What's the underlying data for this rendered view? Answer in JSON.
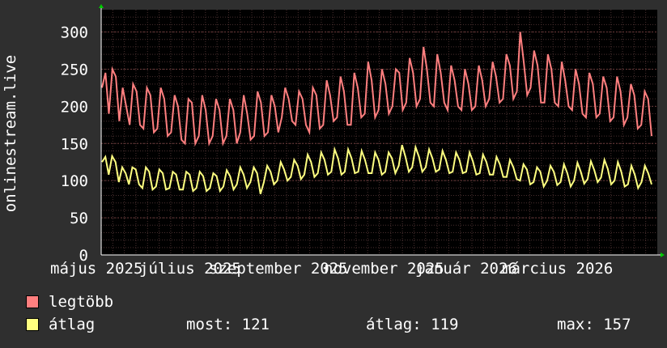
{
  "chart_data": {
    "type": "line",
    "ylabel": "onlinestream.live",
    "ylim": [
      0,
      330
    ],
    "y_ticks": [
      0,
      50,
      100,
      150,
      200,
      250,
      300
    ],
    "x_tick_labels": [
      "május 2025",
      "július 2025",
      "szeptember 2025",
      "november 2025",
      "január 2026",
      "március 2026"
    ],
    "grid": true,
    "background": "#000000",
    "grid_color": "#4a3030",
    "series": [
      {
        "name": "legtöbb",
        "color": "#ff7f7f",
        "values": [
          225,
          245,
          190,
          250,
          240,
          180,
          225,
          200,
          175,
          230,
          220,
          175,
          170,
          225,
          215,
          165,
          170,
          225,
          210,
          160,
          165,
          215,
          200,
          155,
          150,
          210,
          205,
          150,
          160,
          215,
          195,
          150,
          160,
          210,
          195,
          150,
          160,
          210,
          195,
          150,
          165,
          215,
          190,
          155,
          160,
          220,
          205,
          160,
          165,
          215,
          200,
          165,
          185,
          225,
          210,
          180,
          175,
          220,
          210,
          175,
          165,
          225,
          215,
          170,
          175,
          235,
          215,
          180,
          185,
          240,
          220,
          175,
          175,
          245,
          225,
          185,
          190,
          260,
          235,
          185,
          195,
          250,
          230,
          190,
          200,
          250,
          245,
          195,
          205,
          265,
          245,
          200,
          210,
          280,
          250,
          205,
          200,
          270,
          245,
          205,
          195,
          255,
          235,
          200,
          195,
          250,
          230,
          195,
          200,
          255,
          235,
          200,
          210,
          260,
          240,
          205,
          210,
          270,
          255,
          210,
          220,
          300,
          260,
          215,
          225,
          275,
          255,
          205,
          205,
          270,
          250,
          205,
          200,
          260,
          235,
          200,
          195,
          250,
          230,
          190,
          185,
          245,
          230,
          185,
          190,
          240,
          225,
          180,
          185,
          240,
          220,
          175,
          185,
          230,
          215,
          170,
          175,
          220,
          210,
          160
        ]
      },
      {
        "name": "átlag",
        "color": "#ffff80",
        "values": [
          125,
          132,
          108,
          133,
          125,
          98,
          118,
          110,
          95,
          118,
          115,
          95,
          90,
          118,
          112,
          88,
          92,
          115,
          110,
          88,
          90,
          112,
          108,
          88,
          88,
          112,
          108,
          86,
          90,
          112,
          106,
          86,
          90,
          110,
          106,
          86,
          92,
          114,
          106,
          88,
          95,
          118,
          108,
          90,
          98,
          118,
          110,
          82,
          98,
          120,
          112,
          95,
          100,
          125,
          115,
          100,
          105,
          128,
          120,
          102,
          108,
          135,
          125,
          105,
          110,
          138,
          128,
          108,
          112,
          142,
          130,
          108,
          112,
          142,
          130,
          110,
          112,
          140,
          128,
          110,
          110,
          138,
          128,
          108,
          112,
          138,
          130,
          110,
          120,
          148,
          132,
          112,
          118,
          145,
          132,
          112,
          118,
          142,
          130,
          112,
          115,
          140,
          128,
          110,
          112,
          138,
          128,
          110,
          112,
          138,
          126,
          108,
          110,
          135,
          125,
          108,
          108,
          132,
          122,
          105,
          105,
          128,
          118,
          102,
          100,
          122,
          115,
          95,
          98,
          118,
          112,
          92,
          100,
          120,
          112,
          94,
          98,
          122,
          110,
          92,
          100,
          124,
          112,
          96,
          102,
          126,
          114,
          98,
          104,
          128,
          116,
          95,
          100,
          125,
          112,
          92,
          95,
          120,
          108,
          90,
          98,
          120,
          110,
          95
        ]
      }
    ]
  },
  "legend": [
    {
      "label": "legtöbb",
      "color": "#ff7f7f"
    },
    {
      "label": "átlag",
      "color": "#ffff80"
    }
  ],
  "stats": {
    "most": "most: 121",
    "atlag": "átlag: 119",
    "max": "max: 157"
  }
}
